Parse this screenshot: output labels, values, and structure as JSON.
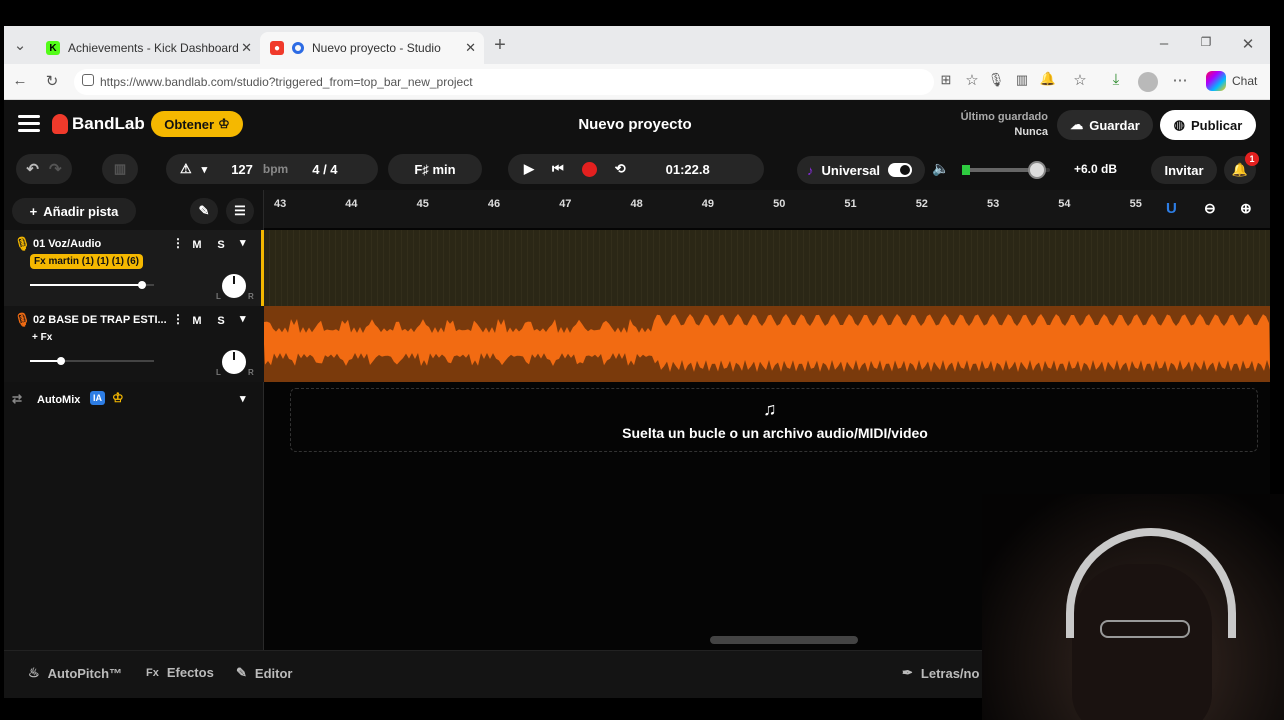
{
  "browser": {
    "tabs": [
      {
        "title": "Achievements - Kick Dashboard",
        "active": false
      },
      {
        "title": "Nuevo proyecto - Studio",
        "active": true
      }
    ],
    "url": "https://www.bandlab.com/studio?triggered_from=top_bar_new_project",
    "chat_label": "Chat"
  },
  "app": {
    "brand": "BandLab",
    "get_button": "Obtener",
    "project_title": "Nuevo proyecto",
    "last_saved_label": "Último guardado",
    "last_saved_value": "Nunca",
    "save_button": "Guardar",
    "publish_button": "Publicar"
  },
  "transport": {
    "bpm_value": "127",
    "bpm_unit": "bpm",
    "time_signature": "4 / 4",
    "key": "F♯ min",
    "time": "01:22.8",
    "instrument": "Universal",
    "gain": "+6.0 dB",
    "invite": "Invitar",
    "notifications": "1",
    "volume_level": 0.85
  },
  "tracks_panel": {
    "add_track": "Añadir pista",
    "tracks": [
      {
        "name": "01  Voz/Audio",
        "fx": "Fx martin (1) (1) (1) (6)",
        "mute": "M",
        "solo": "S",
        "volume": 0.9,
        "pan_l": "L",
        "pan_r": "R"
      },
      {
        "name": "02  BASE DE TRAP ESTI...",
        "fx": "+ Fx",
        "mute": "M",
        "solo": "S",
        "volume": 0.25,
        "pan_l": "L",
        "pan_r": "R"
      }
    ],
    "automix": "AutoMix",
    "automix_badge": "IA"
  },
  "timeline": {
    "bars": [
      "43",
      "44",
      "45",
      "46",
      "47",
      "48",
      "49",
      "50",
      "51",
      "52",
      "53",
      "54",
      "55"
    ],
    "drop_text": "Suelta un bucle o un archivo audio/MIDI/video"
  },
  "bottom": {
    "autopitch": "AutoPitch™",
    "effects_prefix": "Fx",
    "effects": "Efectos",
    "editor": "Editor",
    "lyrics": "Letras/no"
  },
  "colors": {
    "accent_orange": "#f26b12",
    "brand_red": "#f03a2b",
    "get_yellow": "#f5b800",
    "record_red": "#e3201f",
    "track1_bg": "#2b2716"
  }
}
